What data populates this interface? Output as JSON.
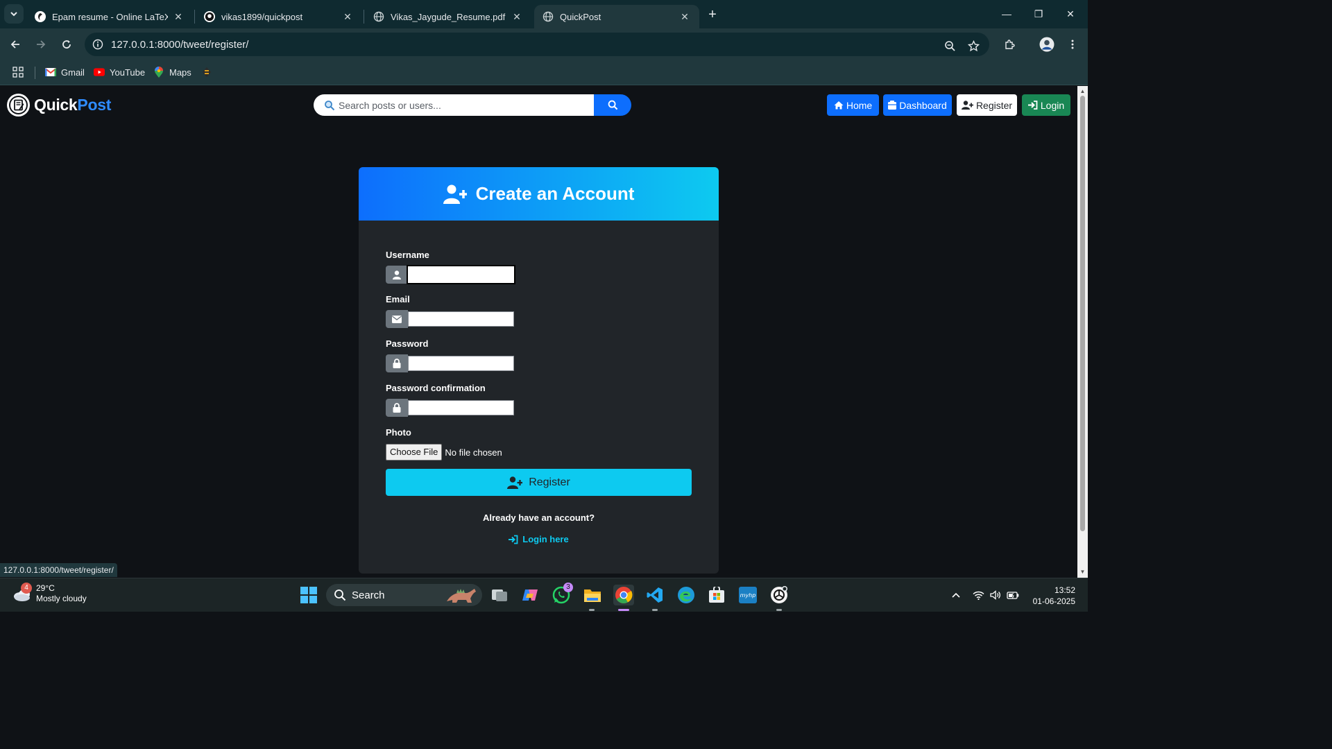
{
  "browser": {
    "tabs": [
      {
        "title": "Epam resume - Online LaTeX Ec",
        "icon": "overleaf-icon"
      },
      {
        "title": "vikas1899/quickpost",
        "icon": "github-icon"
      },
      {
        "title": "Vikas_Jaygude_Resume.pdf",
        "icon": "globe-icon"
      },
      {
        "title": "QuickPost",
        "icon": "globe-icon",
        "active": true
      }
    ],
    "url": "127.0.0.1:8000/tweet/register/",
    "bookmarks": [
      {
        "label": "Gmail",
        "icon": "gmail-icon"
      },
      {
        "label": "YouTube",
        "icon": "youtube-icon"
      },
      {
        "label": "Maps",
        "icon": "maps-icon"
      }
    ],
    "status_url": "127.0.0.1:8000/tweet/register/"
  },
  "site": {
    "brand_first": "Quick",
    "brand_second": "Post",
    "search_placeholder": "Search posts or users...",
    "nav": {
      "home": "Home",
      "dashboard": "Dashboard",
      "register": "Register",
      "login": "Login"
    },
    "colors": {
      "primary": "#0d6efd",
      "info": "#0dcaf0",
      "success": "#198754",
      "card": "#212529"
    }
  },
  "form": {
    "title": "Create an Account",
    "labels": {
      "username": "Username",
      "email": "Email",
      "password": "Password",
      "password_confirmation": "Password confirmation",
      "photo": "Photo"
    },
    "values": {
      "username": "",
      "email": "",
      "password": "",
      "password_confirmation": ""
    },
    "file_button": "Choose File",
    "file_status": "No file chosen",
    "submit": "Register",
    "already": "Already have an account?",
    "login_link": "Login here"
  },
  "taskbar": {
    "weather_temp": "29°C",
    "weather_desc": "Mostly cloudy",
    "weather_badge": "4",
    "search_label": "Search",
    "whatsapp_badge": "3",
    "time": "13:52",
    "date": "01-06-2025"
  }
}
